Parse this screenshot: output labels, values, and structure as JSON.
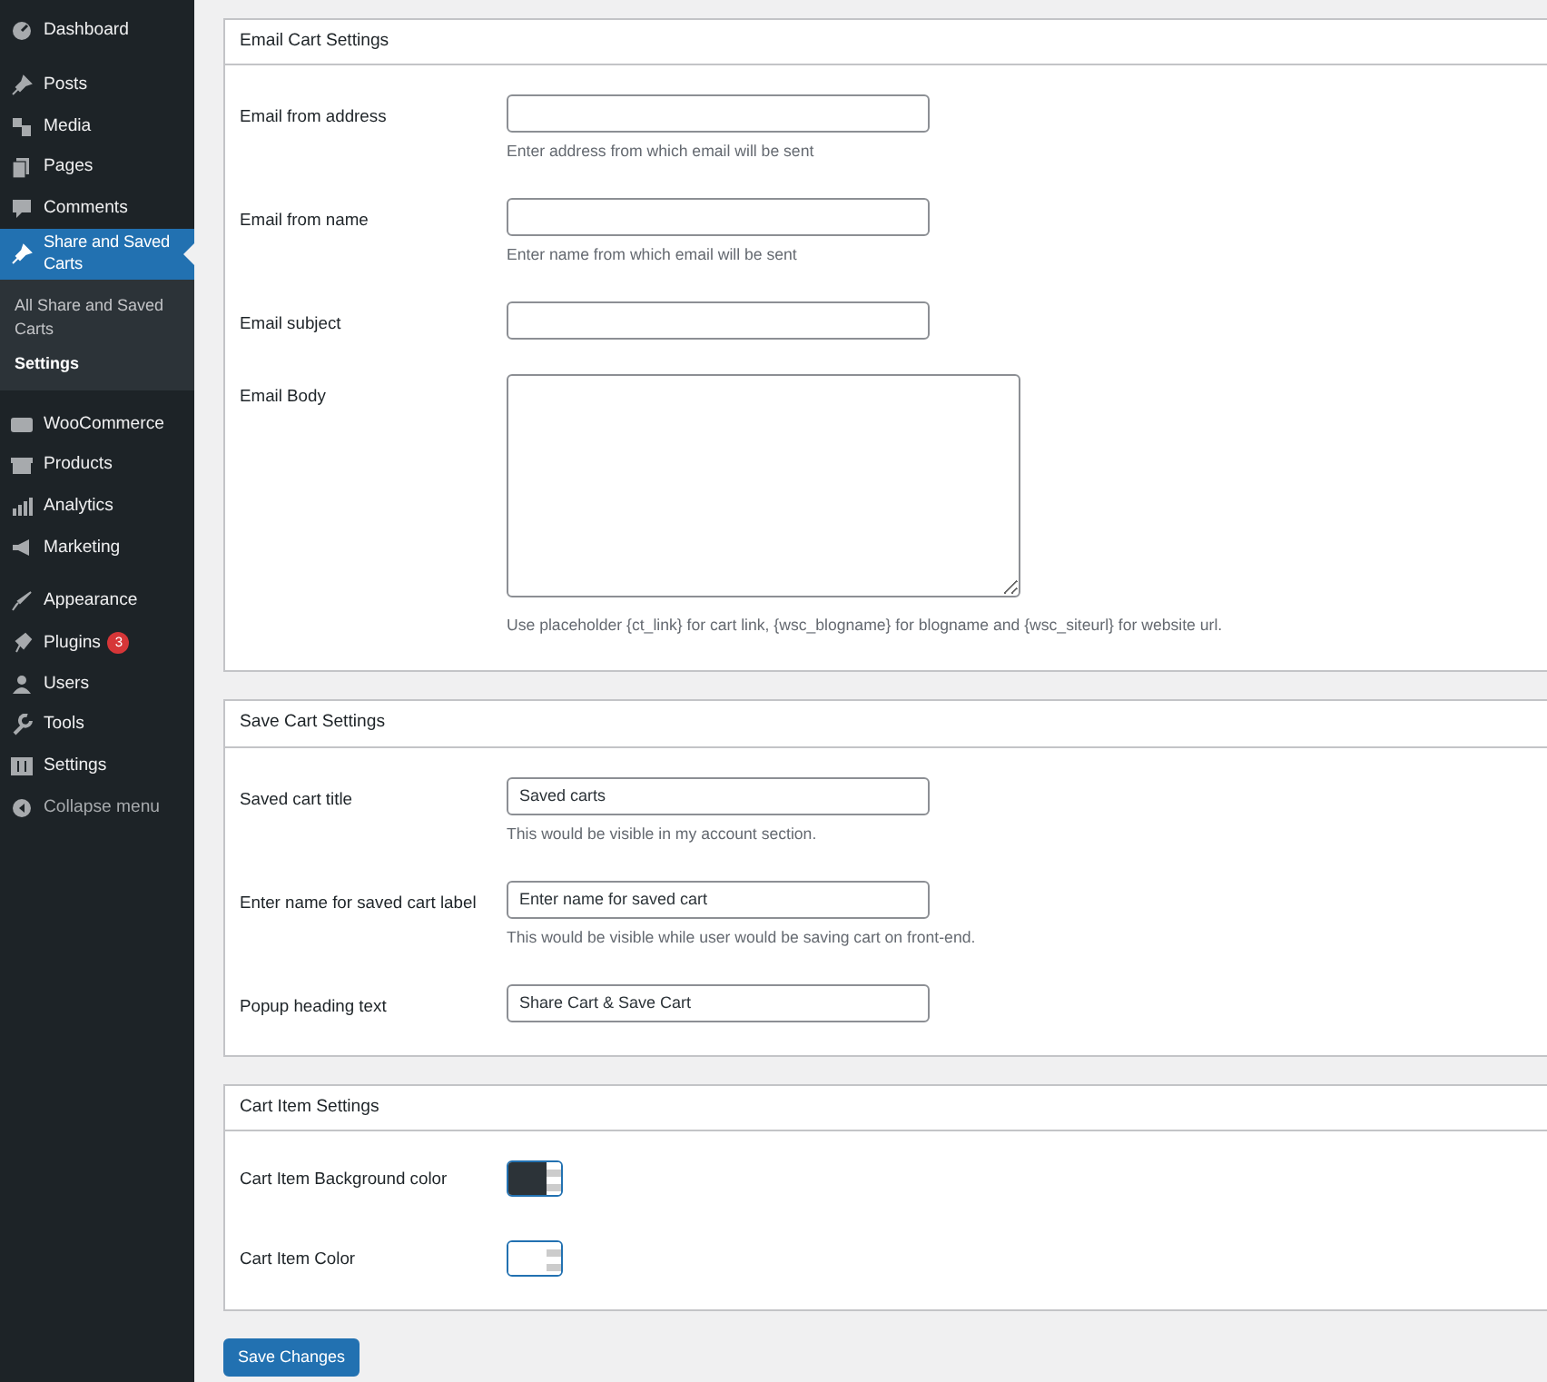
{
  "sidebar": {
    "groups": [
      [
        {
          "label": "Dashboard",
          "selected": false
        }
      ],
      [
        {
          "label": "Posts",
          "selected": false
        },
        {
          "label": "Media",
          "selected": false
        },
        {
          "label": "Pages",
          "selected": false
        },
        {
          "label": "Comments",
          "selected": false
        },
        {
          "label": "Share and Saved Carts",
          "selected": true,
          "children": [
            {
              "label": "All Share and Saved Carts",
              "selected": false
            },
            {
              "label": "Settings",
              "selected": true
            }
          ]
        }
      ],
      [
        {
          "label": "WooCommerce",
          "selected": false
        },
        {
          "label": "Products",
          "selected": false
        },
        {
          "label": "Analytics",
          "selected": false
        },
        {
          "label": "Marketing",
          "selected": false
        }
      ],
      [
        {
          "label": "Appearance",
          "selected": false
        },
        {
          "label": "Plugins",
          "selected": false,
          "badge": "3"
        },
        {
          "label": "Users",
          "selected": false
        },
        {
          "label": "Tools",
          "selected": false
        },
        {
          "label": "Settings",
          "selected": false
        },
        {
          "label": "Collapse menu",
          "selected": false,
          "kind": "collapse"
        }
      ]
    ]
  },
  "sections": [
    {
      "title": "Email Cart Settings",
      "fields": [
        {
          "kind": "text",
          "label": "Email from address",
          "help": "Enter address from which email will be sent"
        },
        {
          "kind": "text",
          "label": "Email from name",
          "help": "Enter name from which email will be sent"
        },
        {
          "kind": "text",
          "label": "Email subject"
        },
        {
          "kind": "textarea",
          "label": "Email Body",
          "help": "Use placeholder {ct_link} for cart link, {wsc_blogname} for blogname and {wsc_siteurl} for website url."
        }
      ]
    },
    {
      "title": "Save Cart Settings",
      "fields": [
        {
          "kind": "text",
          "label": "Saved cart title",
          "value": "Saved carts",
          "help": "This would be visible in my account section."
        },
        {
          "kind": "text",
          "label": "Enter name for saved cart label",
          "value": "Enter name for saved cart",
          "help": "This would be visible while user would be saving cart on front-end."
        },
        {
          "kind": "text",
          "label": "Popup heading text",
          "value": "Share Cart & Save Cart"
        }
      ]
    },
    {
      "title": "Cart Item Settings",
      "fields": [
        {
          "kind": "color",
          "label": "Cart Item Background color",
          "color": "#2c3338"
        },
        {
          "kind": "color",
          "label": "Cart Item Color",
          "color": "#ffffff"
        }
      ]
    }
  ],
  "save_button": "Save Changes"
}
